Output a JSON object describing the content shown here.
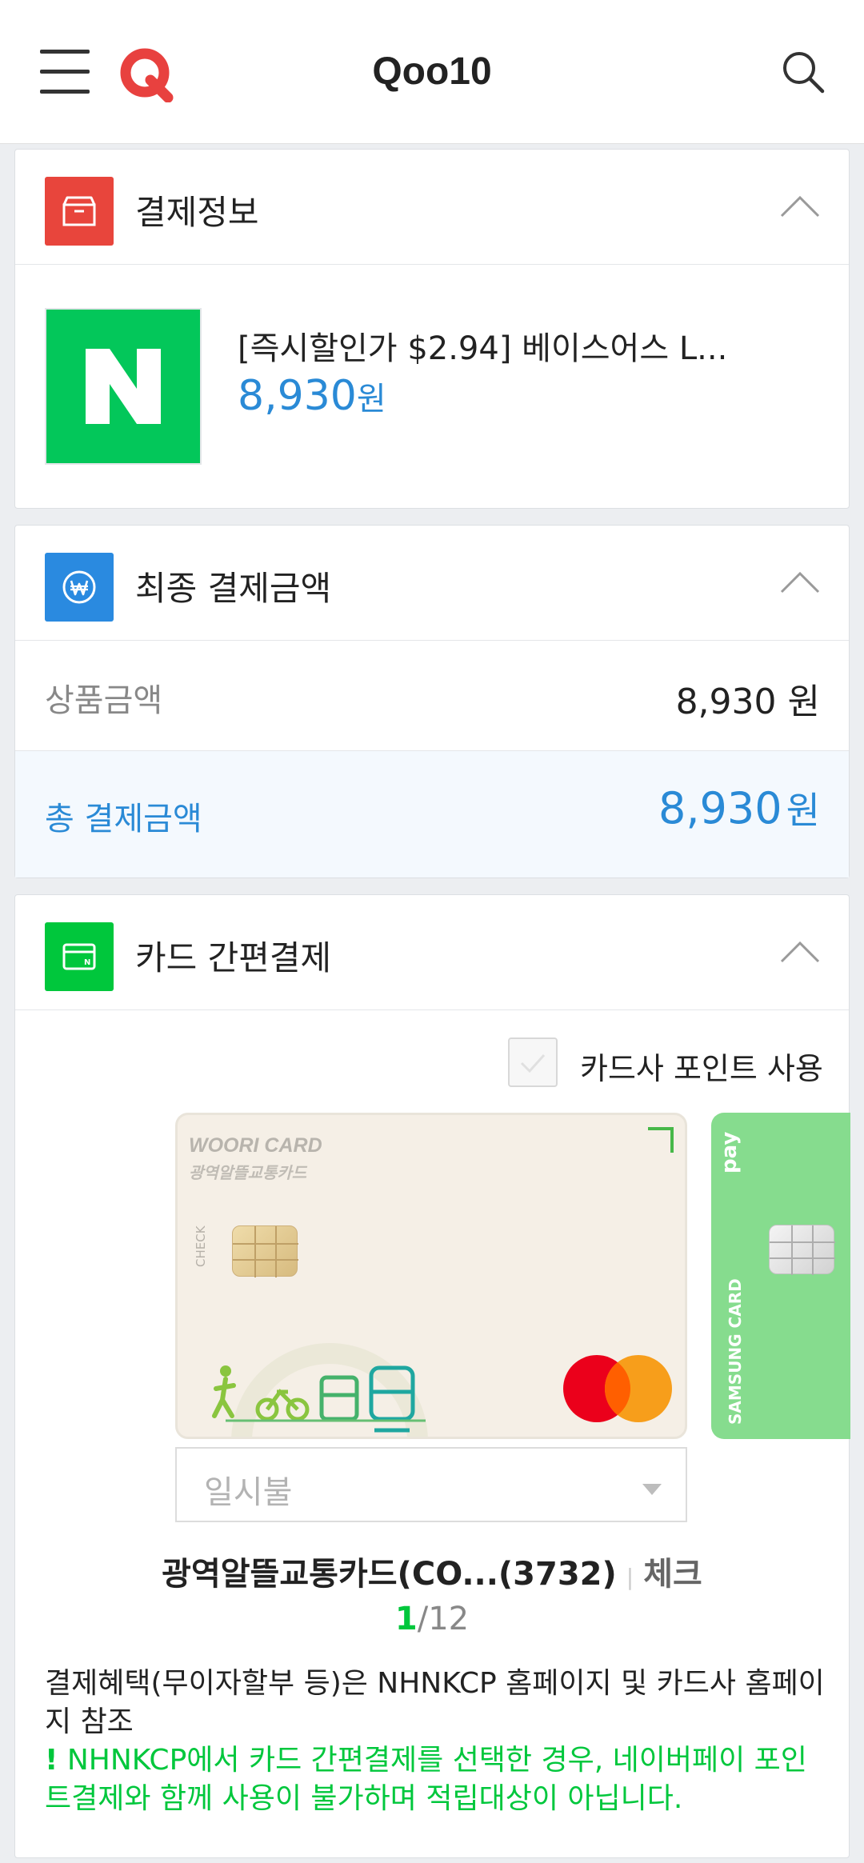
{
  "header": {
    "title": "Qoo10",
    "logo_letter": "Q",
    "menu_icon": "hamburger-menu-icon",
    "search_icon": "search-icon"
  },
  "payment_info": {
    "title": "결제정보",
    "icon": "box-icon",
    "product": {
      "thumb_letter": "N",
      "name": "[즉시할인가 $2.94] 베이스어스 L...",
      "price": "8,930",
      "currency": "원"
    }
  },
  "final_amount": {
    "title": "최종 결제금액",
    "icon": "won-icon",
    "item_label": "상품금액",
    "item_value": "8,930 원",
    "total_label": "총 결제금액",
    "total_value": "8,930",
    "total_currency": "원"
  },
  "card_pay": {
    "title": "카드 간편결제",
    "icon": "card-icon",
    "points_label": "카드사 포인트 사용",
    "card": {
      "brand": "WOORI CARD",
      "product": "광역알뜰교통카드",
      "check_text": "CHECK"
    },
    "next_card": {
      "brand": "SAMSUNG CARD",
      "pay_text": "pay"
    },
    "installment_placeholder": "일시불",
    "card_name": "광역알뜰교통카드(CO...(3732)",
    "card_separator": "|",
    "card_type": "체크",
    "pager_current": "1",
    "pager_total": "/12",
    "notice": "결제혜택(무이자할부 등)은 NHNKCP 홈페이지 및 카드사 홈페이지 참조",
    "warning_mark": "!",
    "warning": " NHNKCP에서 카드 간편결제를 선택한 경우, 네이버페이 포인트결제와 함께 사용이 불가하며 적립대상이 아닙니다."
  },
  "colors": {
    "accent_blue": "#2a8ad6",
    "naver_green": "#03c75a",
    "qoo10_red": "#e8413f",
    "box_icon_red": "#e8453c"
  }
}
